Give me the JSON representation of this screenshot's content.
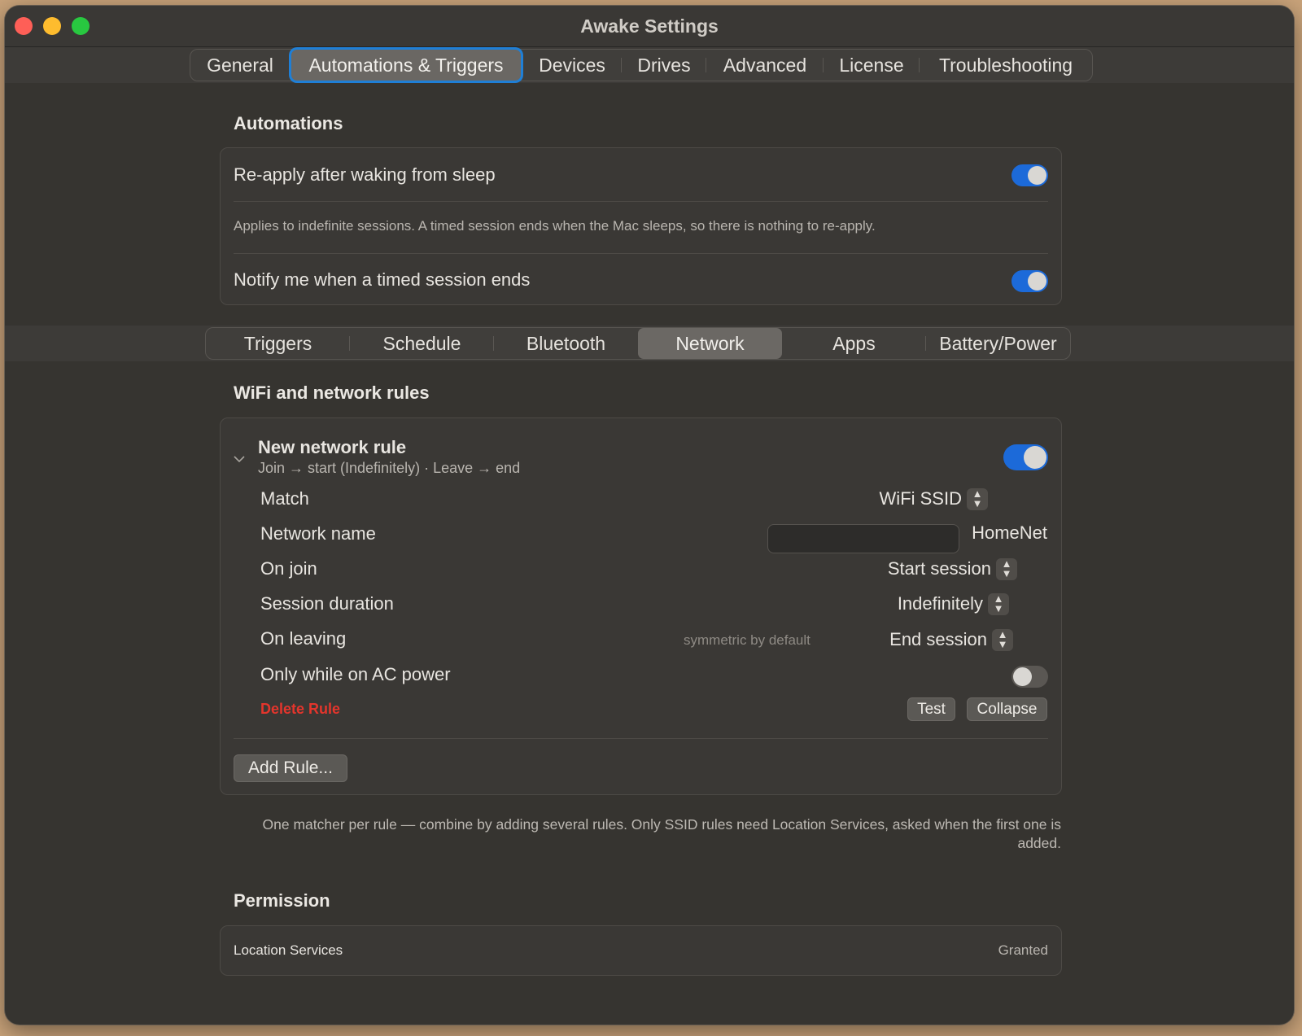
{
  "window": {
    "title": "Awake Settings"
  },
  "main_tabs": [
    {
      "label": "General",
      "active": false
    },
    {
      "label": "Automations & Triggers",
      "active": true
    },
    {
      "label": "Devices",
      "active": false
    },
    {
      "label": "Drives",
      "active": false
    },
    {
      "label": "Advanced",
      "active": false
    },
    {
      "label": "License",
      "active": false
    },
    {
      "label": "Troubleshooting",
      "active": false
    }
  ],
  "automations": {
    "title": "Automations",
    "reapply_label": "Re-apply after waking from sleep",
    "reapply_on": true,
    "reapply_note": "Applies to indefinite sessions. A timed session ends when the Mac sleeps, so there is nothing to re-apply.",
    "notify_label": "Notify me when a timed session ends",
    "notify_on": true
  },
  "sub_tabs": [
    {
      "label": "Triggers",
      "active": false
    },
    {
      "label": "Schedule",
      "active": false
    },
    {
      "label": "Bluetooth",
      "active": false
    },
    {
      "label": "Network",
      "active": true
    },
    {
      "label": "Apps",
      "active": false
    },
    {
      "label": "Battery/Power",
      "active": false
    }
  ],
  "network": {
    "title": "WiFi and network rules",
    "rule": {
      "name": "New network rule",
      "summary": "Join → start (Indefinitely) · Leave → end",
      "enabled": true,
      "match_label": "Match",
      "match_value": "WiFi SSID",
      "network_name_label": "Network name",
      "network_name_value": "",
      "network_name_display": "HomeNet",
      "on_join_label": "On join",
      "on_join_value": "Start session",
      "duration_label": "Session duration",
      "duration_value": "Indefinitely",
      "on_leaving_label": "On leaving",
      "on_leaving_hint": "symmetric by default",
      "on_leaving_value": "End session",
      "ac_power_label": "Only while on AC power",
      "ac_power_on": false,
      "delete_label": "Delete Rule",
      "test_label": "Test",
      "collapse_label": "Collapse"
    },
    "add_rule_label": "Add Rule...",
    "footnote": "One matcher per rule — combine by adding several rules. Only SSID rules need Location Services, asked when the first one is added."
  },
  "permission": {
    "title": "Permission",
    "item_label": "Location Services",
    "item_status": "Granted"
  },
  "icons": {
    "stepper": "up-down-chevron-icon",
    "disclosure": "chevron-down-icon"
  },
  "colors": {
    "accent": "#1c6ad9",
    "focus_ring": "#1f7fd6",
    "destructive": "#e4352c"
  }
}
